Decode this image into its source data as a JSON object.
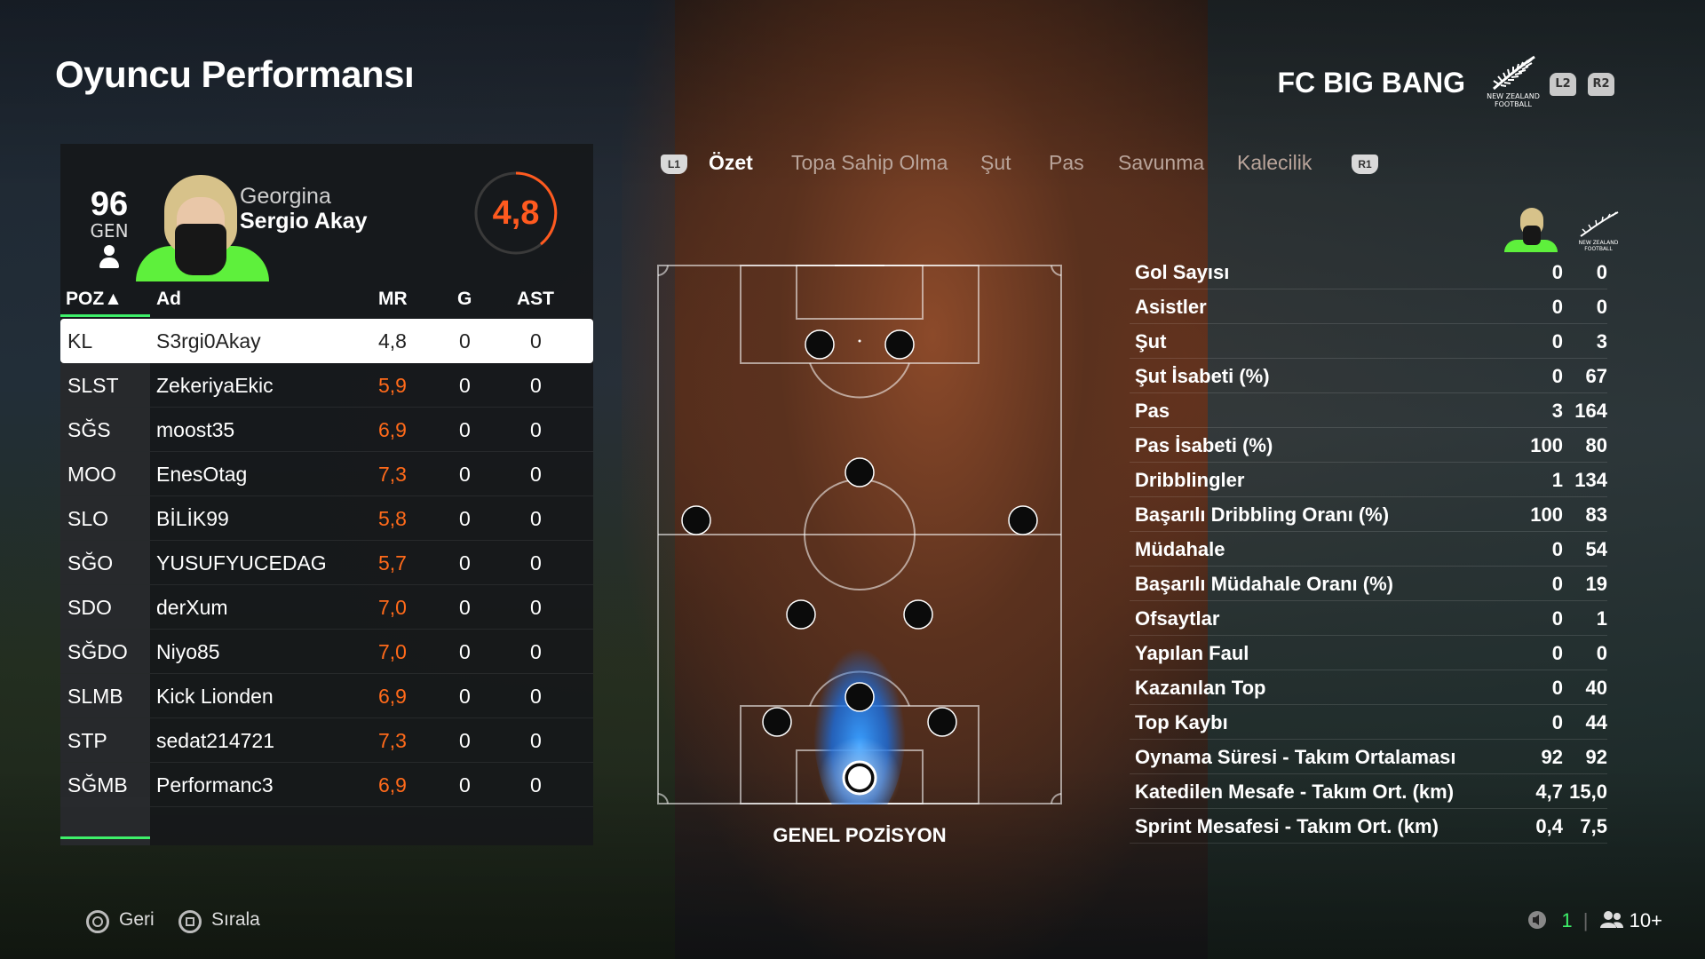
{
  "page_title": "Oyuncu Performansı",
  "club_name": "FC BIG BANG",
  "club_badge_text": "NEW ZEALAND FOOTBALL",
  "buttons": {
    "l2": "L2",
    "r2": "R2",
    "l1": "L1",
    "r1": "R1"
  },
  "player": {
    "gen_value": "96",
    "gen_label": "GEN",
    "first_name": "Georgina",
    "last_name": "Sergio Akay",
    "rating": "4,8"
  },
  "table": {
    "headers": {
      "pos": "POZ▲",
      "name": "Ad",
      "mr": "MR",
      "g": "G",
      "ast": "AST"
    },
    "rows": [
      {
        "pos": "KL",
        "name": "S3rgi0Akay",
        "mr": "4,8",
        "g": "0",
        "ast": "0"
      },
      {
        "pos": "SLST",
        "name": "ZekeriyaEkic",
        "mr": "5,9",
        "g": "0",
        "ast": "0"
      },
      {
        "pos": "SĞS",
        "name": "moost35",
        "mr": "6,9",
        "g": "0",
        "ast": "0"
      },
      {
        "pos": "MOO",
        "name": "EnesOtag",
        "mr": "7,3",
        "g": "0",
        "ast": "0"
      },
      {
        "pos": "SLO",
        "name": "BİLİK99",
        "mr": "5,8",
        "g": "0",
        "ast": "0"
      },
      {
        "pos": "SĞO",
        "name": "YUSUFYUCEDAG",
        "mr": "5,7",
        "g": "0",
        "ast": "0"
      },
      {
        "pos": "SDO",
        "name": "derXum",
        "mr": "7,0",
        "g": "0",
        "ast": "0"
      },
      {
        "pos": "SĞDO",
        "name": "Niyo85",
        "mr": "7,0",
        "g": "0",
        "ast": "0"
      },
      {
        "pos": "SLMB",
        "name": "Kick Lionden",
        "mr": "6,9",
        "g": "0",
        "ast": "0"
      },
      {
        "pos": "STP",
        "name": "sedat214721",
        "mr": "7,3",
        "g": "0",
        "ast": "0"
      },
      {
        "pos": "SĞMB",
        "name": "Performanc3",
        "mr": "6,9",
        "g": "0",
        "ast": "0"
      }
    ]
  },
  "tabs": [
    "Özet",
    "Topa Sahip Olma",
    "Şut",
    "Pas",
    "Savunma",
    "Kalecilik"
  ],
  "pitch_label": "GENEL POZİSYON",
  "stats": [
    {
      "label": "Gol Sayısı",
      "player": "0",
      "team": "0"
    },
    {
      "label": "Asistler",
      "player": "0",
      "team": "0"
    },
    {
      "label": "Şut",
      "player": "0",
      "team": "3"
    },
    {
      "label": "Şut İsabeti (%)",
      "player": "0",
      "team": "67"
    },
    {
      "label": "Pas",
      "player": "3",
      "team": "164"
    },
    {
      "label": "Pas İsabeti (%)",
      "player": "100",
      "team": "80"
    },
    {
      "label": "Dribblingler",
      "player": "1",
      "team": "134"
    },
    {
      "label": "Başarılı Dribbling Oranı (%)",
      "player": "100",
      "team": "83"
    },
    {
      "label": "Müdahale",
      "player": "0",
      "team": "54"
    },
    {
      "label": "Başarılı Müdahale Oranı (%)",
      "player": "0",
      "team": "19"
    },
    {
      "label": "Ofsaytlar",
      "player": "0",
      "team": "1"
    },
    {
      "label": "Yapılan Faul",
      "player": "0",
      "team": "0"
    },
    {
      "label": "Kazanılan Top",
      "player": "0",
      "team": "40"
    },
    {
      "label": "Top Kaybı",
      "player": "0",
      "team": "44"
    },
    {
      "label": "Oynama Süresi - Takım Ortalaması",
      "player": "92",
      "team": "92"
    },
    {
      "label": "Katedilen Mesafe - Takım Ort. (km)",
      "player": "4,7",
      "team": "15,0"
    },
    {
      "label": "Sprint Mesafesi - Takım Ort. (km)",
      "player": "0,4",
      "team": "7,5"
    }
  ],
  "footer": {
    "back": "Geri",
    "sort": "Sırala",
    "count": "1",
    "players": "10+"
  },
  "colors": {
    "accent_green": "#3ef06a",
    "rating_orange": "#ff5a1f",
    "heat_blue": "#2a8cff"
  }
}
